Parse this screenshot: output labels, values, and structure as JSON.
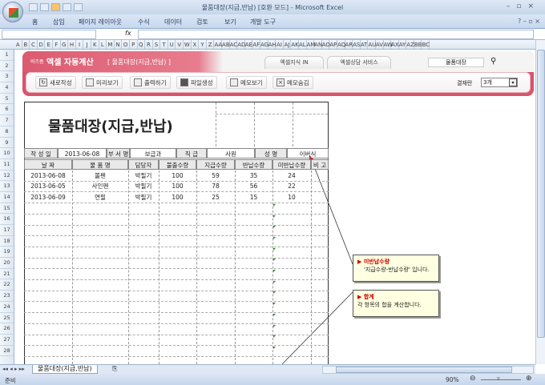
{
  "window": {
    "title": "물품대장(지급,반납)  [호환 모드] - Microsoft Excel"
  },
  "ribbon": {
    "tabs": [
      "홈",
      "삽입",
      "페이지 레이아웃",
      "수식",
      "데이터",
      "검토",
      "보기",
      "개발 도구"
    ]
  },
  "formula": {
    "fx": "fx"
  },
  "columns": [
    "A",
    "B",
    "C",
    "D",
    "E",
    "F",
    "G",
    "H",
    "I",
    "J",
    "K",
    "L",
    "M",
    "N",
    "O",
    "P",
    "Q",
    "R",
    "S",
    "T",
    "U",
    "V",
    "W",
    "X",
    "Y",
    "Z",
    "AA",
    "AB",
    "AC",
    "AD",
    "AE",
    "AF",
    "AG",
    "AH",
    "AI",
    "AJ",
    "AK",
    "AL",
    "AM",
    "AN",
    "AO",
    "AP",
    "AQ",
    "AR",
    "AS",
    "AT",
    "AU",
    "AV",
    "AW",
    "AX",
    "AY",
    "AZ",
    "BB",
    "BC"
  ],
  "rows": [
    "1",
    "2",
    "3",
    "4",
    "5",
    "6",
    "7",
    "8",
    "9",
    "10",
    "11",
    "12",
    "13",
    "14",
    "15",
    "16",
    "17",
    "18",
    "19",
    "20",
    "21",
    "22",
    "23",
    "24",
    "25",
    "26",
    "27",
    "28"
  ],
  "banner": {
    "logo_small": "비즈폼",
    "brand": "엑셀 자동계산",
    "subtitle": "[ 물품대장(지급,반납) ]",
    "tab1": "엑셀지식 IN",
    "tab2": "엑셀상담 서비스",
    "search_value": "물품대장",
    "buttons": [
      "새로작성",
      "미리보기",
      "출력하기",
      "파일생성",
      "메모보기",
      "메모숨김"
    ],
    "approval_label": "결재란",
    "approval_value": "3개"
  },
  "form": {
    "title": "물품대장(지급,반납)",
    "info": {
      "date_label": "작 성 일",
      "date": "2013-06-08",
      "dept_label": "부 서 명",
      "dept": "보급과",
      "rank_label": "직 급",
      "rank": "사원",
      "name_label": "성 명",
      "name": "이버식"
    },
    "headers": [
      "날  짜",
      "물 품 명",
      "담당자",
      "불출수량",
      "지급수량",
      "반납수량",
      "미반납수량",
      "비 고"
    ],
    "rows": [
      [
        "2013-06-08",
        "볼펜",
        "박필기",
        "100",
        "59",
        "35",
        "24",
        ""
      ],
      [
        "2013-06-05",
        "사인펜",
        "박필기",
        "100",
        "78",
        "56",
        "22",
        ""
      ],
      [
        "2013-06-09",
        "연필",
        "박필기",
        "100",
        "25",
        "15",
        "10",
        ""
      ]
    ]
  },
  "notes": [
    {
      "title": "미반납수량",
      "body": "'지급수량-반납수량' 입니다."
    },
    {
      "title": "합계",
      "body": "각 항목의 합을 계산합니다."
    }
  ],
  "sheet_tab": "물품대장(지급,반납)",
  "status": {
    "ready": "준비",
    "zoom": "90%"
  }
}
